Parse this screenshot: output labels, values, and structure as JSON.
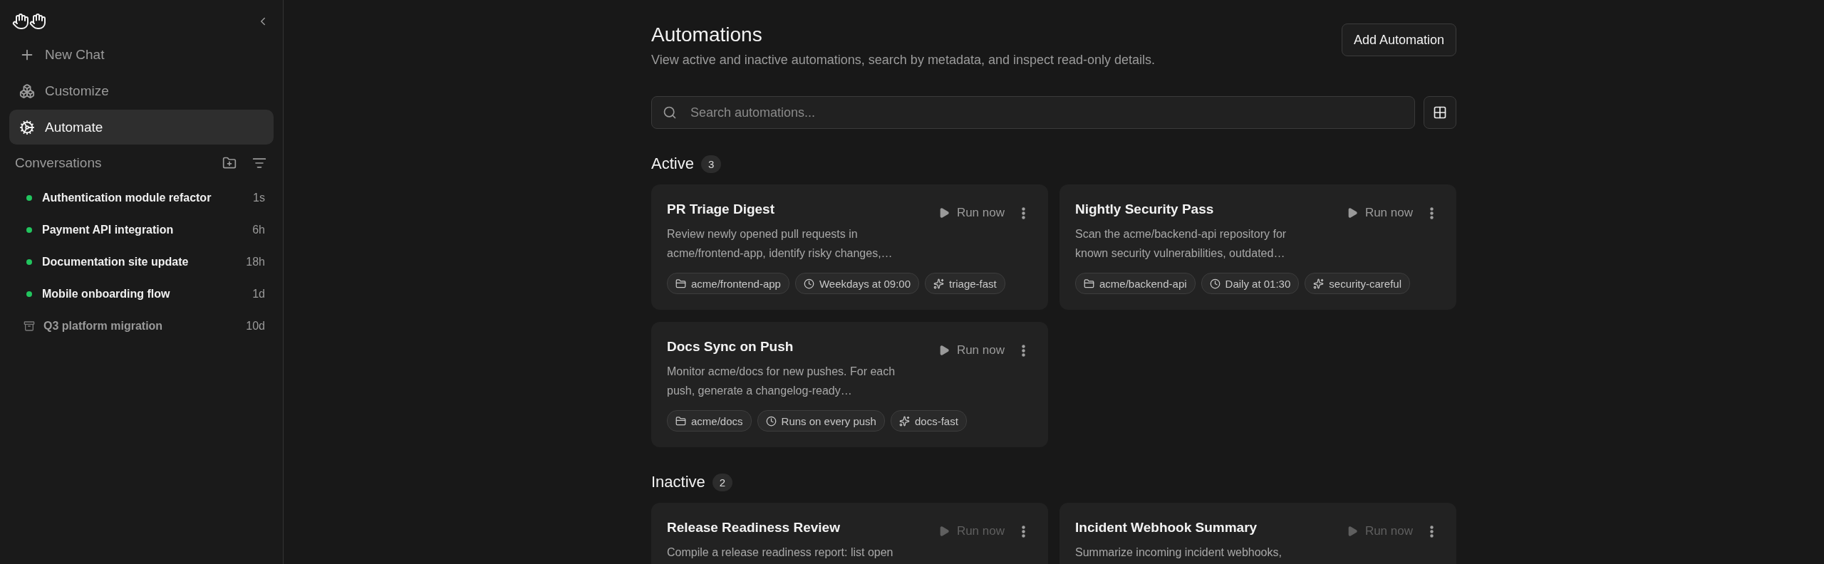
{
  "sidebar": {
    "nav": [
      {
        "kind": "new",
        "label": "New Chat",
        "selected": false
      },
      {
        "kind": "customize",
        "label": "Customize",
        "selected": false
      },
      {
        "kind": "automate",
        "label": "Automate",
        "selected": true
      }
    ],
    "conversations_title": "Conversations",
    "conversations": [
      {
        "kind": "active",
        "title": "Authentication module refactor",
        "age": "1s"
      },
      {
        "kind": "active",
        "title": "Payment API integration",
        "age": "6h"
      },
      {
        "kind": "active",
        "title": "Documentation site update",
        "age": "18h"
      },
      {
        "kind": "active",
        "title": "Mobile onboarding flow",
        "age": "1d"
      },
      {
        "kind": "archived",
        "title": "Q3 platform migration",
        "age": "10d"
      }
    ]
  },
  "header": {
    "title": "Automations",
    "subtitle": "View active and inactive automations, search by metadata, and inspect read-only details.",
    "add_button": "Add Automation"
  },
  "search": {
    "placeholder": "Search automations..."
  },
  "sections": [
    {
      "title": "Active",
      "count": "3",
      "automations": [
        {
          "title": "PR Triage Digest",
          "description": "Review newly opened pull requests in acme/frontend-app, identify risky changes,…",
          "run_label": "Run now",
          "run_disabled": false,
          "tags": [
            {
              "kind": "repo",
              "label": "acme/frontend-app"
            },
            {
              "kind": "schedule",
              "label": "Weekdays at 09:00"
            },
            {
              "kind": "model",
              "label": "triage-fast"
            }
          ]
        },
        {
          "title": "Nightly Security Pass",
          "description": "Scan the acme/backend-api repository for known security vulnerabilities, outdated…",
          "run_label": "Run now",
          "run_disabled": false,
          "tags": [
            {
              "kind": "repo",
              "label": "acme/backend-api"
            },
            {
              "kind": "schedule",
              "label": "Daily at 01:30"
            },
            {
              "kind": "model",
              "label": "security-careful"
            }
          ]
        },
        {
          "title": "Docs Sync on Push",
          "description": "Monitor acme/docs for new pushes. For each push, generate a changelog-ready…",
          "run_label": "Run now",
          "run_disabled": false,
          "tags": [
            {
              "kind": "repo",
              "label": "acme/docs"
            },
            {
              "kind": "schedule",
              "label": "Runs on every push"
            },
            {
              "kind": "model",
              "label": "docs-fast"
            }
          ]
        }
      ]
    },
    {
      "title": "Inactive",
      "count": "2",
      "automations": [
        {
          "title": "Release Readiness Review",
          "description": "Compile a release readiness report: list open",
          "run_label": "Run now",
          "run_disabled": true
        },
        {
          "title": "Incident Webhook Summary",
          "description": "Summarize incoming incident webhooks,",
          "run_label": "Run now",
          "run_disabled": true
        }
      ]
    }
  ]
}
